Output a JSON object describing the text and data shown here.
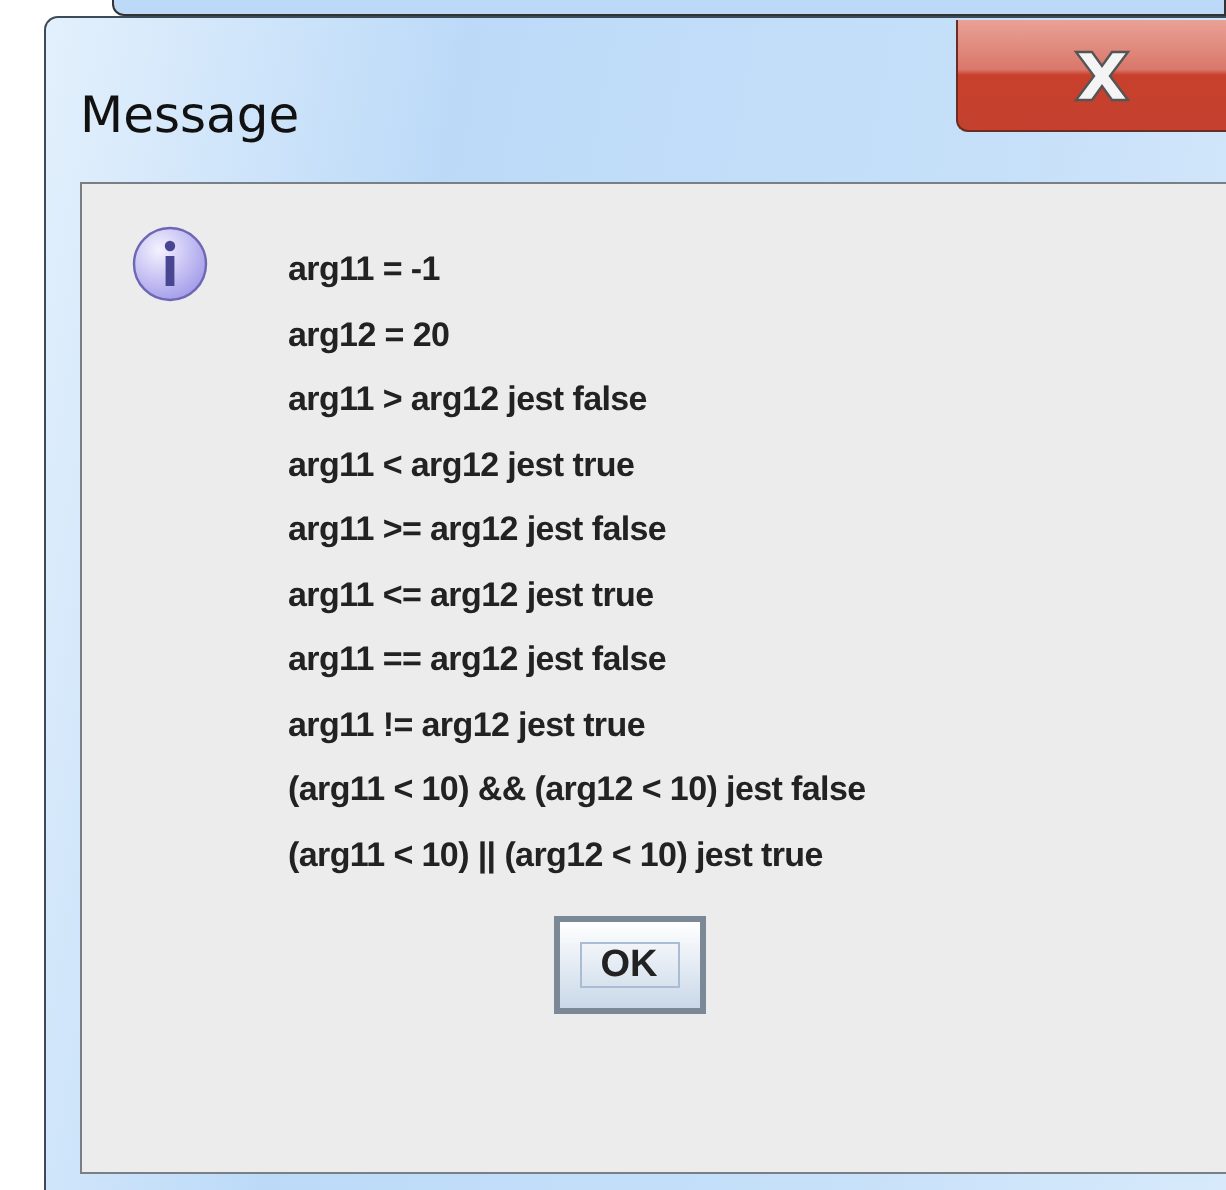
{
  "window": {
    "title": "Message"
  },
  "message": {
    "lines": [
      "arg11 = -1",
      "arg12 = 20",
      "arg11 > arg12 jest false",
      "arg11 < arg12 jest true",
      "arg11 >= arg12 jest false",
      "arg11 <= arg12 jest true",
      "arg11 == arg12 jest false",
      "arg11 != arg12 jest true",
      "(arg11 < 10) && (arg12 < 10) jest false",
      "(arg11 < 10) || (arg12 < 10) jest true"
    ]
  },
  "buttons": [
    "OK"
  ]
}
